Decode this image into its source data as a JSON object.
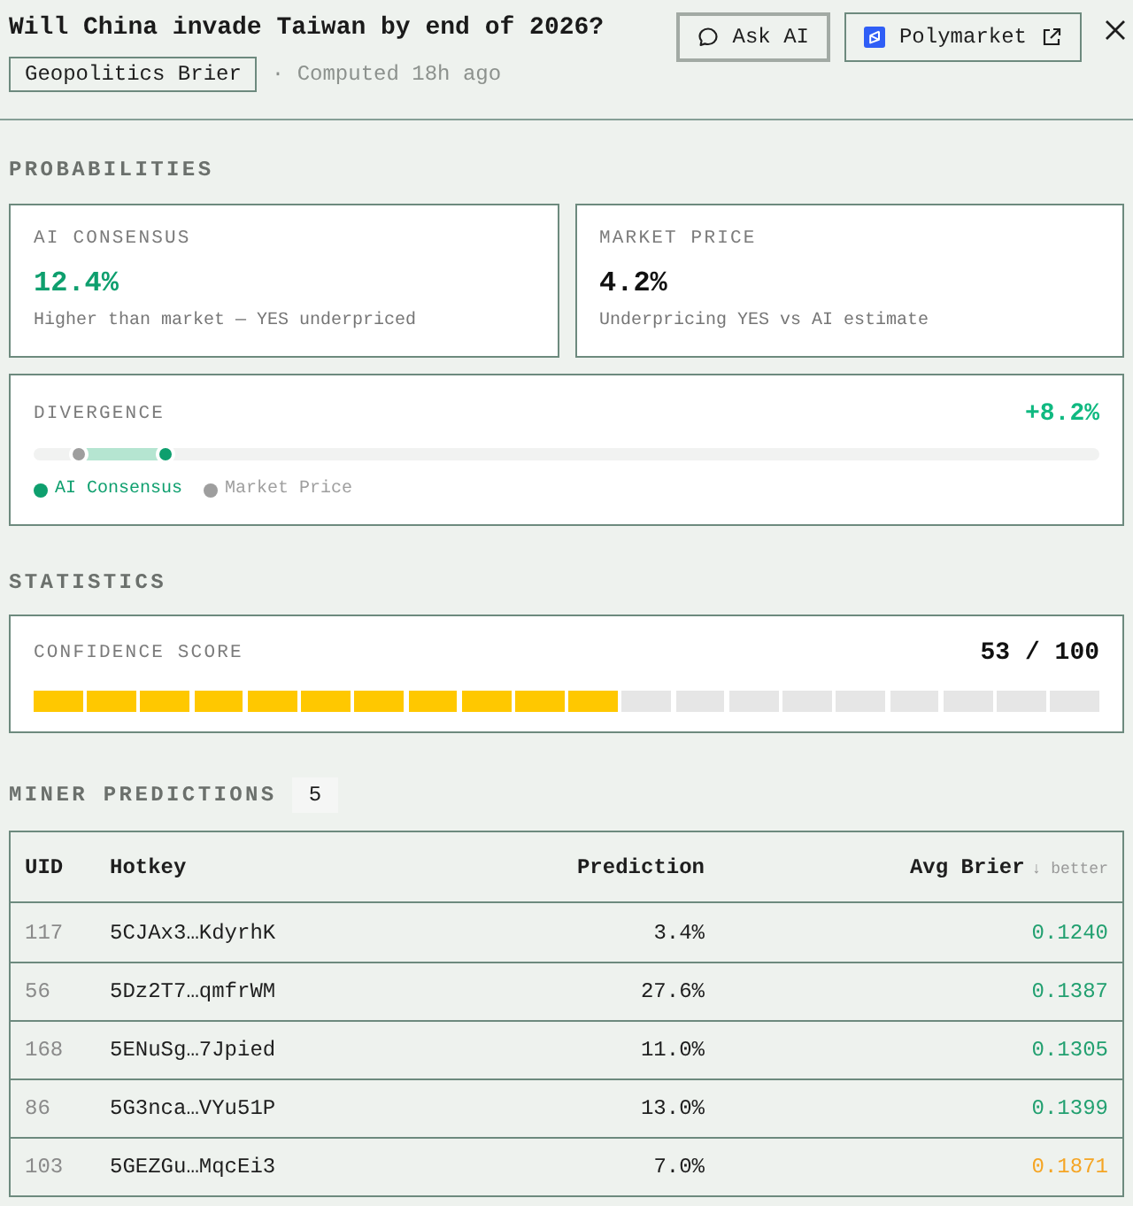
{
  "header": {
    "title": "Will China invade Taiwan by end of 2026?",
    "tag": "Geopolitics Brier",
    "computed": "· Computed 18h ago",
    "buttons": [
      {
        "kind": "chat",
        "label": "Ask AI"
      },
      {
        "kind": "external",
        "label": "Polymarket"
      }
    ]
  },
  "probabilities": {
    "heading": "PROBABILITIES",
    "cards": [
      {
        "label": "AI CONSENSUS",
        "value": "12.4%",
        "note": "Higher than market — YES underpriced",
        "color": "#0e9f6e"
      },
      {
        "label": "MARKET PRICE",
        "value": "4.2%",
        "note": "Underpricing YES vs AI estimate",
        "color": "#111111"
      }
    ],
    "divergence": {
      "label": "DIVERGENCE",
      "value": "+8.2%",
      "markers": [
        {
          "level": 0.124
        },
        {
          "level": 0.042
        }
      ],
      "legend": [
        {
          "label": "AI Consensus",
          "color": "#0e9f6e"
        },
        {
          "label": "Market Price",
          "color": "#9e9e9e"
        }
      ]
    }
  },
  "statistics": {
    "heading": "STATISTICS",
    "confidence": {
      "label": "CONFIDENCE SCORE",
      "reading": "53 / 100",
      "level": 0.53
    }
  },
  "miners": {
    "heading": "MINER PREDICTIONS",
    "count": "5",
    "columns": [
      {
        "label": "UID"
      },
      {
        "label": "Hotkey"
      },
      {
        "label": "Prediction"
      },
      {
        "label": "Avg Brier",
        "note": "↓ better"
      }
    ],
    "rows": [
      {
        "uid": "117",
        "hotkey": "5CJAx3…KdyrhK",
        "prediction": "3.4%",
        "avg_brier": "0.1240",
        "color": "#22a070"
      },
      {
        "uid": "56",
        "hotkey": "5Dz2T7…qmfrWM",
        "prediction": "27.6%",
        "avg_brier": "0.1387",
        "color": "#22a070"
      },
      {
        "uid": "168",
        "hotkey": "5ENuSg…7Jpied",
        "prediction": "11.0%",
        "avg_brier": "0.1305",
        "color": "#22a070"
      },
      {
        "uid": "86",
        "hotkey": "5G3nca…VYu51P",
        "prediction": "13.0%",
        "avg_brier": "0.1399",
        "color": "#22a070"
      },
      {
        "uid": "103",
        "hotkey": "5GEZGu…MqcEi3",
        "prediction": "7.0%",
        "avg_brier": "0.1871",
        "color": "#f5a524"
      }
    ]
  }
}
